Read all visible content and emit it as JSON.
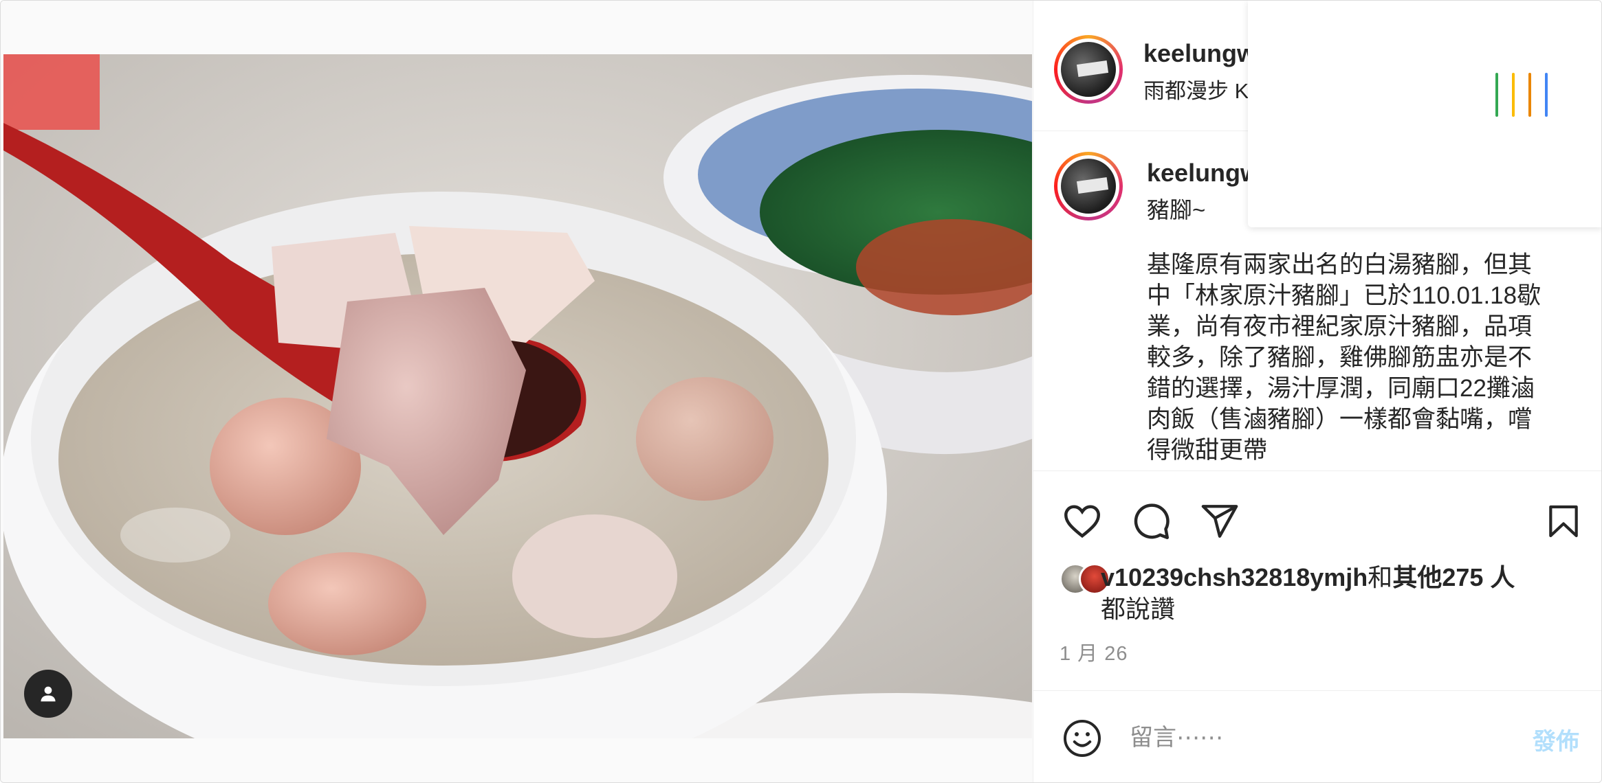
{
  "post": {
    "username": "keelungw",
    "location": "雨都漫步 K",
    "caption_username": "keelungw",
    "caption_first_line": "豬腳~",
    "caption_body": "基隆原有兩家出名的白湯豬腳，但其中「林家原汁豬腳」已於110.01.18歇業，尚有夜市裡紀家原汁豬腳，品項較多，除了豬腳，雞佛腳筋盅亦是不錯的選擇，湯汁厚潤，同廟口22攤滷肉飯（售滷豬腳）一樣都會黏嘴，嚐得微甜更帶",
    "likes_user": "v10239chsh32818ymjh",
    "likes_and": "和",
    "likes_others": "其他275 人",
    "likes_suffix": "都說讚",
    "date": "1 月 26"
  },
  "comment": {
    "placeholder": "留言⋯⋯",
    "post_label": "發佈"
  },
  "icons": {
    "like": "heart-icon",
    "comment": "comment-icon",
    "share": "share-icon",
    "save": "bookmark-icon",
    "emoji": "emoji-icon",
    "tag": "user-tag-icon"
  },
  "colors": {
    "post_button": "#b2dffc",
    "loader": [
      "#34a853",
      "#fbbc05",
      "#ea8600",
      "#4285f4"
    ]
  }
}
